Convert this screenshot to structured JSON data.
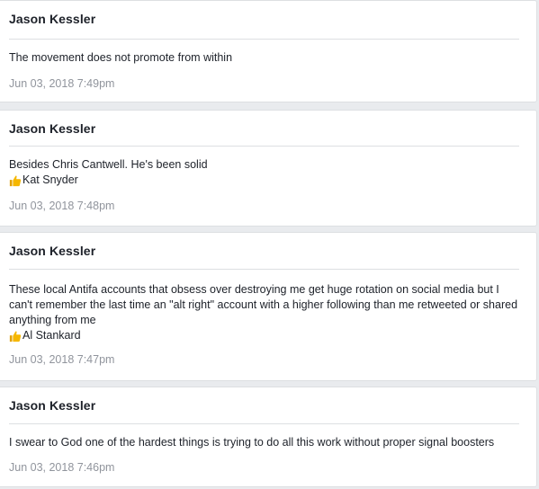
{
  "posts": [
    {
      "author": "Jason Kessler",
      "text": "The movement does not promote from within",
      "timestamp": "Jun 03, 2018 7:49pm"
    },
    {
      "author": "Jason Kessler",
      "text": "Besides Chris Cantwell. He's been solid",
      "like": "Kat Snyder",
      "timestamp": "Jun 03, 2018 7:48pm"
    },
    {
      "author": "Jason Kessler",
      "text": "These local Antifa accounts that obsess over destroying me get huge rotation on social media but I can't remember the last time an \"alt right\" account with a higher following than me retweeted or shared anything from me",
      "like": "Al Stankard",
      "timestamp": "Jun 03, 2018 7:47pm"
    },
    {
      "author": "Jason Kessler",
      "text": "I swear to God one of the hardest things is trying to do all this work without proper signal boosters",
      "timestamp": "Jun 03, 2018 7:46pm"
    }
  ],
  "icons": {
    "like": "thumbs-up-icon"
  },
  "colors": {
    "background": "#e9ebee",
    "card": "#ffffff",
    "text": "#1d2129",
    "timestamp": "#90949c",
    "thumb": "#f5b700"
  }
}
